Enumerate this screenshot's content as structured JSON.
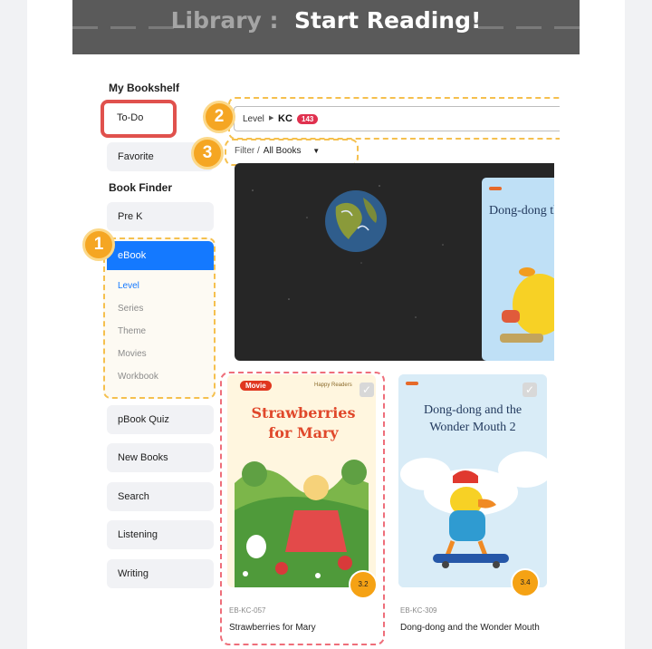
{
  "banner": {
    "library": "Library :",
    "title": "Start Reading!"
  },
  "sidebar": {
    "bookshelf_title": "My Bookshelf",
    "todo": "To-Do",
    "favorite": "Favorite",
    "finder_title": "Book Finder",
    "prek": "Pre K",
    "ebook": "eBook",
    "ebook_items": [
      "Level",
      "Series",
      "Theme",
      "Movies",
      "Workbook"
    ],
    "pbook_quiz": "pBook Quiz",
    "new_books": "New Books",
    "search": "Search",
    "listening": "Listening",
    "writing": "Writing"
  },
  "callouts": [
    "1",
    "2",
    "3"
  ],
  "level_bar": {
    "label": "Level",
    "level": "KC",
    "count": "143"
  },
  "filter": {
    "label": "Filter /",
    "value": "All Books"
  },
  "hero_book": {
    "title": "Dong-dong the Wonder"
  },
  "books": [
    {
      "tag": "Movie",
      "publisher": "Happy Readers",
      "cover_title": "Strawberries for Mary",
      "level": "3.2",
      "code": "EB-KC-057",
      "title": "Strawberries for Mary"
    },
    {
      "cover_title": "Dong-dong and the Wonder Mouth 2",
      "level": "3.4",
      "code": "EB-KC-309",
      "title": "Dong-dong and the Wonder Mouth"
    }
  ],
  "colors": {
    "accent": "#1479ff",
    "highlight": "#e0514d",
    "callout": "#f5a623",
    "count_badge": "#e0314f"
  }
}
